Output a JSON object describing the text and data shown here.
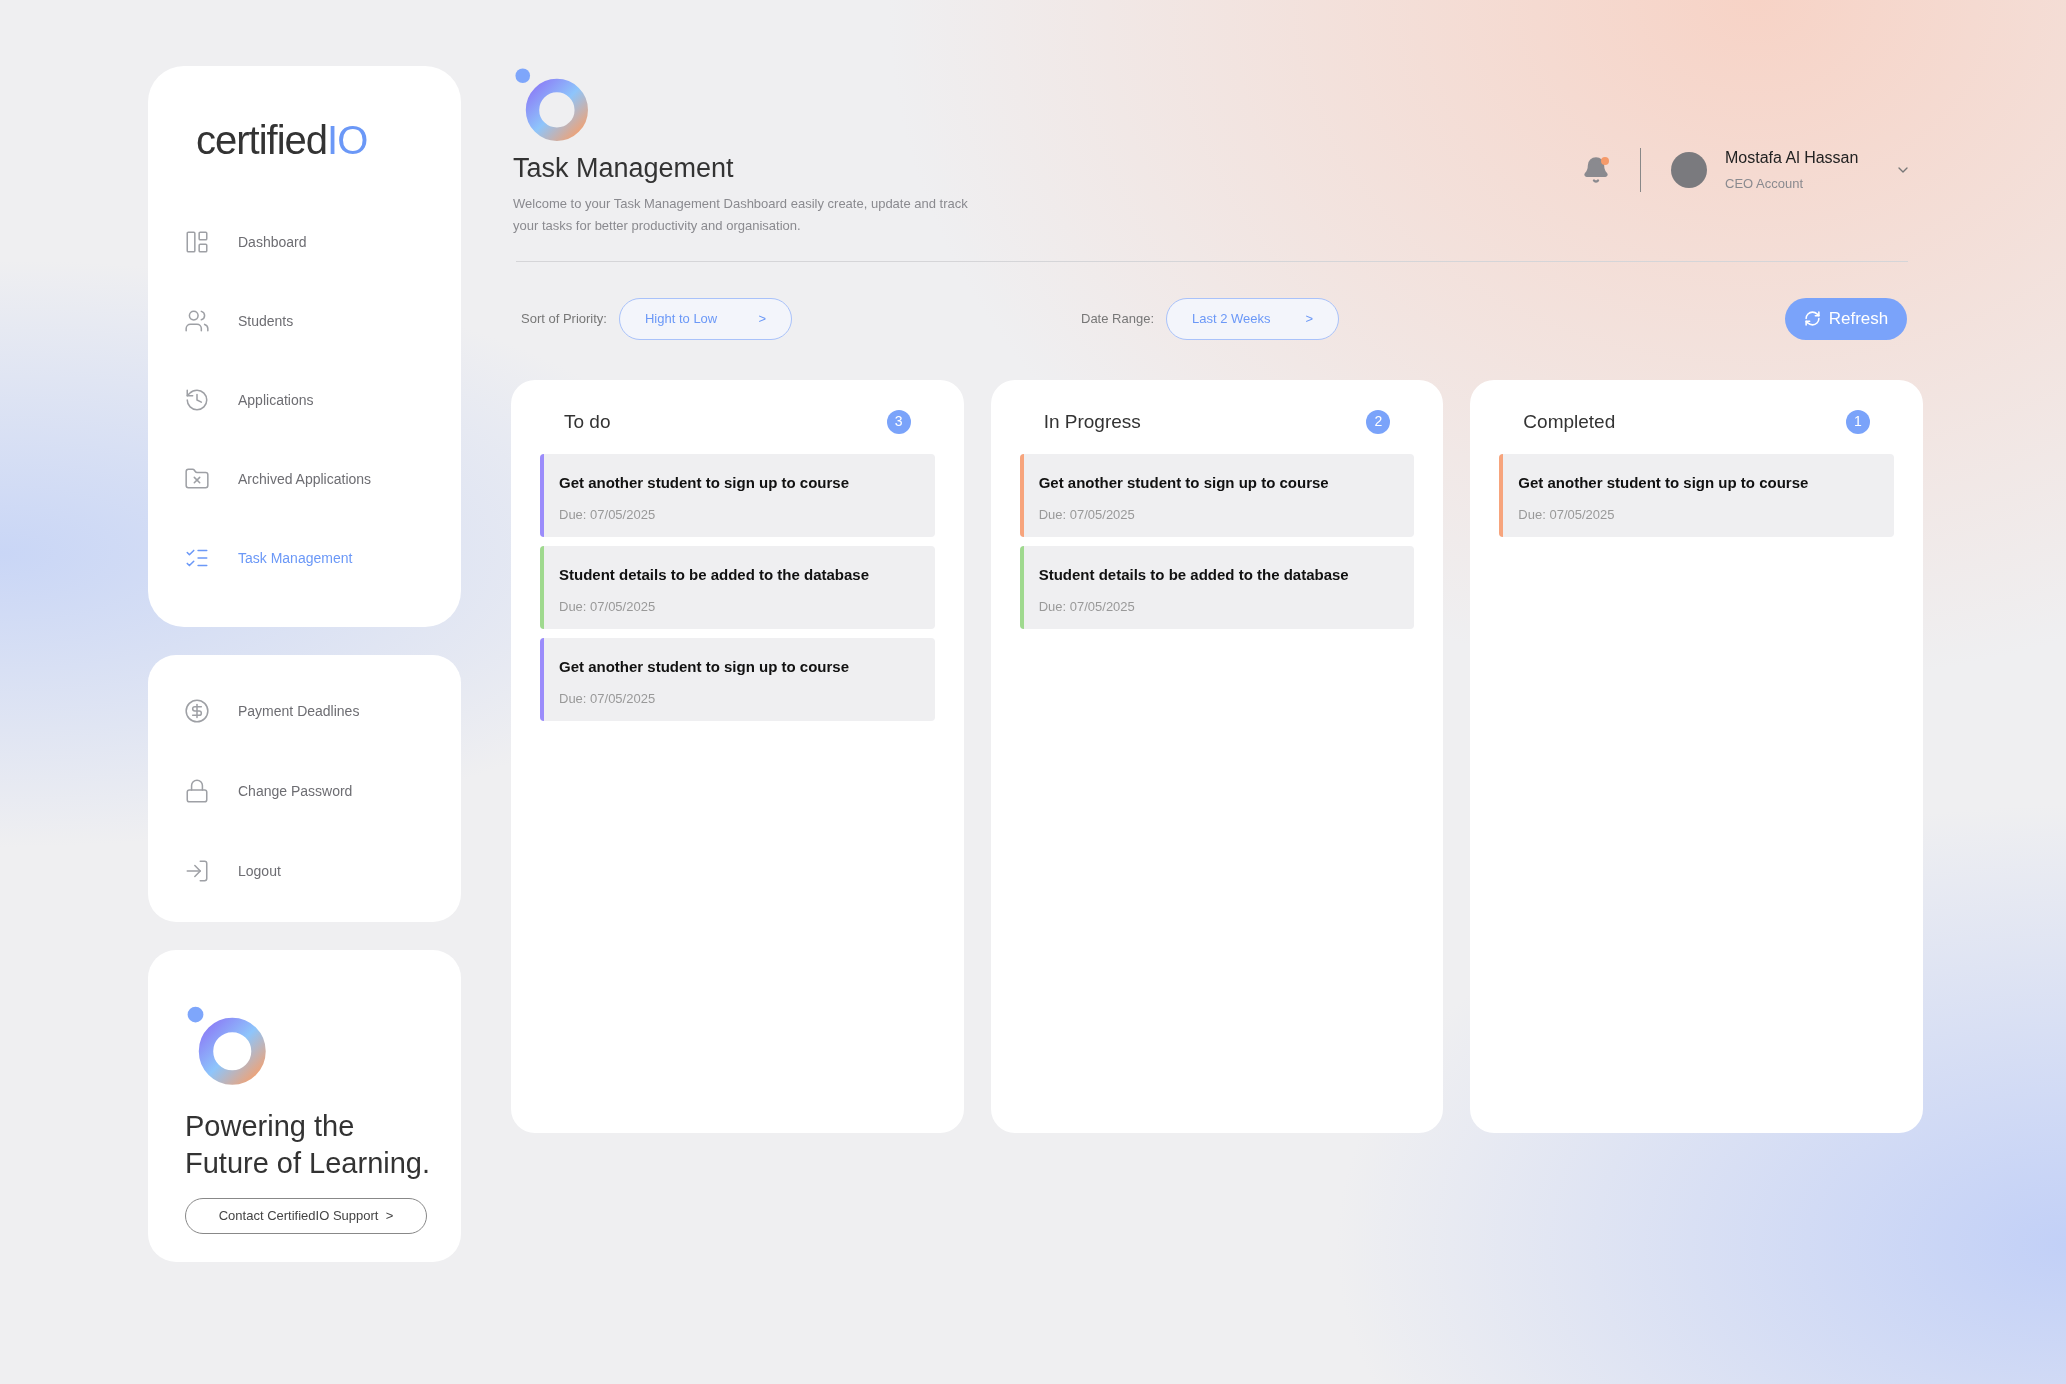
{
  "sidebar": {
    "logo": {
      "text": "certified",
      "accent": "IO"
    },
    "nav": [
      {
        "label": "Dashboard",
        "selected": false
      },
      {
        "label": "Students",
        "selected": false
      },
      {
        "label": "Applications",
        "selected": false
      },
      {
        "label": "Archived Applications",
        "selected": false
      },
      {
        "label": "Task Management",
        "selected": true
      }
    ],
    "account_nav": [
      {
        "label": "Payment Deadlines",
        "selected": false
      },
      {
        "label": "Change Password",
        "selected": false
      },
      {
        "label": "Logout",
        "selected": false
      }
    ],
    "promo": {
      "heading": "Powering the Future of Learning.",
      "button": "Contact CertifiedIO Support  >"
    }
  },
  "header": {
    "title": "Task Management",
    "subtitle": "Welcome to your Task Management Dashboard easily create, update and track your tasks for better productivity and organisation.",
    "notifications": {
      "unread": true
    },
    "user": {
      "name": "Mostafa Al Hassan",
      "role": "CEO Account"
    }
  },
  "filters": [
    {
      "label": "Sort of Priority:",
      "value": "Hight to Low",
      "arrow": ">"
    },
    {
      "label": "Date Range:",
      "value": "Last 2 Weeks",
      "arrow": ">"
    }
  ],
  "refresh_button": "Refresh",
  "columns": [
    {
      "title": "To do",
      "count": "3",
      "tasks": [
        {
          "title": "Get another student to sign up to course",
          "due": "Due: 07/05/2025",
          "color": "#9b8cfb"
        },
        {
          "title": "Student details to be added to the database",
          "due": "Due: 07/05/2025",
          "color": "#9fd98e"
        },
        {
          "title": "Get another student to sign up to course",
          "due": "Due: 07/05/2025",
          "color": "#9b8cfb"
        }
      ]
    },
    {
      "title": "In Progress",
      "count": "2",
      "tasks": [
        {
          "title": "Get another student to sign up to course",
          "due": "Due: 07/05/2025",
          "color": "#f7a47c"
        },
        {
          "title": "Student details to be added to the database",
          "due": "Due: 07/05/2025",
          "color": "#9fd98e"
        }
      ]
    },
    {
      "title": "Completed",
      "count": "1",
      "tasks": [
        {
          "title": "Get another student to sign up to course",
          "due": "Due: 07/05/2025",
          "color": "#f7a47c"
        }
      ]
    }
  ]
}
